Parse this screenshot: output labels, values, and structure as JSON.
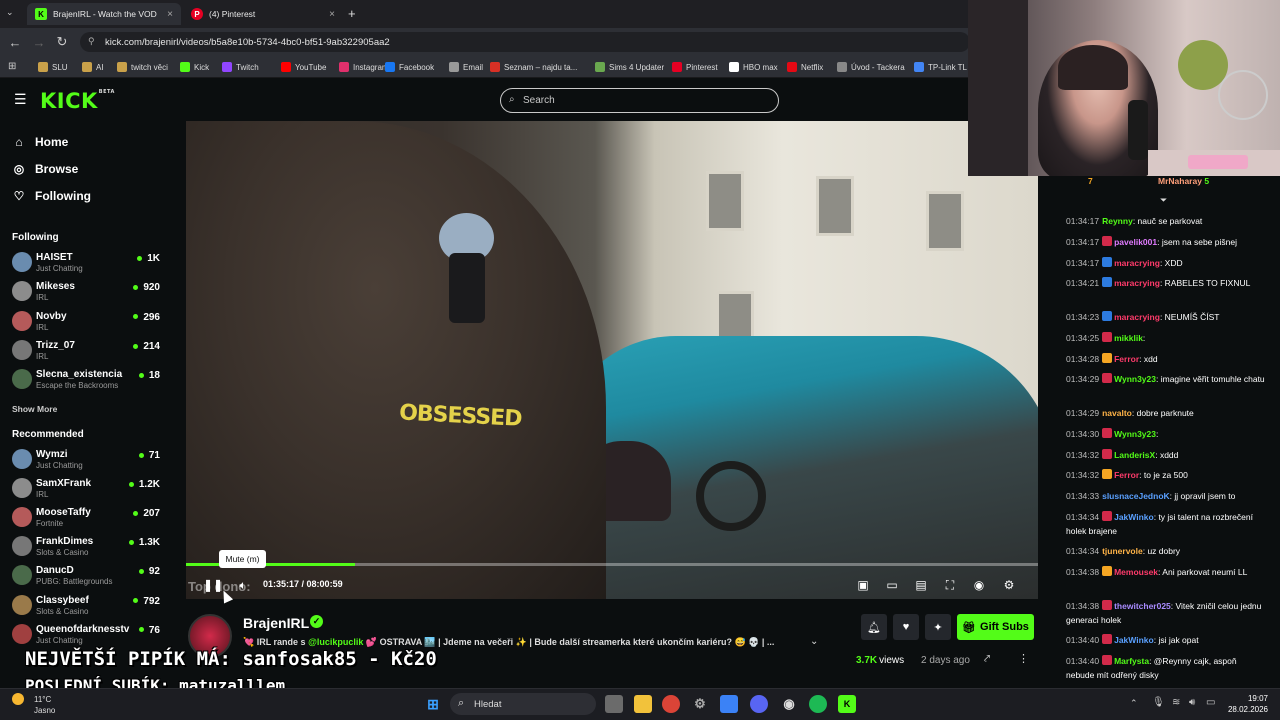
{
  "browser": {
    "tabs": [
      {
        "label": "BrajenIRL - Watch the VOD",
        "active": true
      },
      {
        "label": "(4) Pinterest",
        "active": false
      }
    ],
    "url": "kick.com/brajenirl/videos/b5a8e10b-5734-4bc0-bf51-9ab322905aa2",
    "bookmarks": [
      "SLU",
      "AI",
      "twitch věci",
      "Kick",
      "Twitch",
      "YouTube",
      "Instagram",
      "Facebook",
      "Email",
      "Seznam – najdu ta...",
      "Sims 4 Updater",
      "Pinterest",
      "HBO max",
      "Netflix",
      "Úvod - Tackera",
      "TP-Link TL"
    ]
  },
  "header": {
    "logo": "KICK",
    "logo_badge": "BETA",
    "search_placeholder": "Search"
  },
  "sidebar": {
    "nav": [
      {
        "label": "Home",
        "icon": "home-icon"
      },
      {
        "label": "Browse",
        "icon": "compass-icon"
      },
      {
        "label": "Following",
        "icon": "heart-icon"
      }
    ],
    "following_title": "Following",
    "following": [
      {
        "name": "HAISET",
        "category": "Just Chatting",
        "viewers": "1K"
      },
      {
        "name": "Mikeses",
        "category": "IRL",
        "viewers": "920"
      },
      {
        "name": "Novby",
        "category": "IRL",
        "viewers": "296"
      },
      {
        "name": "Trizz_07",
        "category": "IRL",
        "viewers": "214"
      },
      {
        "name": "Slecna_existencia",
        "category": "Escape the Backrooms",
        "viewers": "18"
      }
    ],
    "show_more": "Show More",
    "recommended_title": "Recommended",
    "recommended": [
      {
        "name": "Wymzi",
        "category": "Just Chatting",
        "viewers": "71"
      },
      {
        "name": "SamXFrank",
        "category": "IRL",
        "viewers": "1.2K"
      },
      {
        "name": "MooseTaffy",
        "category": "Fortnite",
        "viewers": "207"
      },
      {
        "name": "FrankDimes",
        "category": "Slots & Casino",
        "viewers": "1.3K"
      },
      {
        "name": "DanucD",
        "category": "PUBG: Battlegrounds",
        "viewers": "92"
      },
      {
        "name": "Classybeef",
        "category": "Slots & Casino",
        "viewers": "792"
      },
      {
        "name": "Queenofdarknesstv",
        "category": "Just Chatting",
        "viewers": "76"
      }
    ]
  },
  "player": {
    "tooltip": "Mute (m)",
    "overlay_top_text": "Top dono:",
    "time_current": "01:35:17",
    "time_total": "08:00:59",
    "progress": 0.198,
    "hoodie_text": "OBSESSED"
  },
  "stream": {
    "channel": "BrajenIRL",
    "title_prefix": "💘 IRL rande s ",
    "title_mention": "@lucikpuclik",
    "title_suffix": " 💕 OSTRAVA 🏙️ | Jdeme na večeři ✨ | Bude další streamerka které ukončím kariéru? 😅 💀 | ...",
    "views": "3.7K",
    "views_label": "views",
    "ago": "2 days ago",
    "gift_subs": "Gift Subs"
  },
  "overlay": {
    "line1": "NEJVĚTŠÍ PIPÍK MÁ: sanfosak85 - Kč20",
    "line2": "POSLEDNÍ SUBÍK: matuzalllem"
  },
  "chat": {
    "top_user": "MrNaharay",
    "top_count": "5",
    "messages": [
      {
        "t": "01:34:17",
        "user": "Reynny",
        "text": "nauč se parkovat",
        "color": "#53fc18",
        "badge": ""
      },
      {
        "t": "01:34:17",
        "user": "pavelik001",
        "text": "jsem na sebe pišnej",
        "color": "#e17bff",
        "badge": "#d22a4a"
      },
      {
        "t": "01:34:17",
        "user": "maracrying",
        "text": "XDD",
        "color": "#ff3b6b",
        "badge": "#2d7be0"
      },
      {
        "t": "01:34:21",
        "user": "maracrying",
        "text": "RABELES TO FIXNUL",
        "color": "#ff3b6b",
        "badge": "#2d7be0"
      },
      {
        "t": "01:34:23",
        "user": "maracrying",
        "text": "NEUMÍŠ ČÍST",
        "color": "#ff3b6b",
        "badge": "#2d7be0"
      },
      {
        "t": "01:34:25",
        "user": "mikklik",
        "text": "",
        "color": "#53fc18",
        "badge": "#d22a4a"
      },
      {
        "t": "01:34:28",
        "user": "Ferror",
        "text": "xdd",
        "color": "#ff3b6b",
        "badge": "#f5a623"
      },
      {
        "t": "01:34:29",
        "user": "Wynn3y23",
        "text": "imagine věřit tomuhle chatu",
        "color": "#53fc18",
        "badge": "#d22a4a"
      },
      {
        "t": "01:34:29",
        "user": "navalto",
        "text": "dobre parknute",
        "color": "#ffb347",
        "badge": ""
      },
      {
        "t": "01:34:30",
        "user": "Wynn3y23",
        "text": "",
        "color": "#53fc18",
        "badge": "#d22a4a"
      },
      {
        "t": "01:34:32",
        "user": "LanderisX",
        "text": "xddd",
        "color": "#53fc18",
        "badge": "#d22a4a"
      },
      {
        "t": "01:34:32",
        "user": "Ferror",
        "text": "to je za 500",
        "color": "#ff3b6b",
        "badge": "#f5a623"
      },
      {
        "t": "01:34:33",
        "user": "slusnaceJednoK",
        "text": "jj opravil jsem to",
        "color": "#5aa0ff",
        "badge": ""
      },
      {
        "t": "01:34:34",
        "user": "JakWinko",
        "text": "ty jsi talent na rozbrečení holek brajene",
        "color": "#5aa0ff",
        "badge": "#d22a4a"
      },
      {
        "t": "01:34:34",
        "user": "tjunervole",
        "text": "uz dobry",
        "color": "#ffb347",
        "badge": ""
      },
      {
        "t": "01:34:38",
        "user": "Memousek",
        "text": "Ani parkovat neumí LL",
        "color": "#ff3b6b",
        "badge": "#f5a623"
      },
      {
        "t": "01:34:38",
        "user": "thewitcher025",
        "text": "Vitek zničil celou jednu generaci holek",
        "color": "#a98bff",
        "badge": "#d22a4a"
      },
      {
        "t": "01:34:40",
        "user": "JakWinko",
        "text": "jsi jak opat",
        "color": "#5aa0ff",
        "badge": "#d22a4a"
      },
      {
        "t": "01:34:40",
        "user": "Marfysta",
        "text": "@Reynny cajk, aspoň nebude mít odřený disky",
        "color": "#53fc18",
        "badge": "#d22a4a"
      }
    ]
  },
  "taskbar": {
    "temp": "11°C",
    "weather": "Jasno",
    "search_placeholder": "Hledat",
    "time": "19:07",
    "date": "28.02.2026"
  }
}
